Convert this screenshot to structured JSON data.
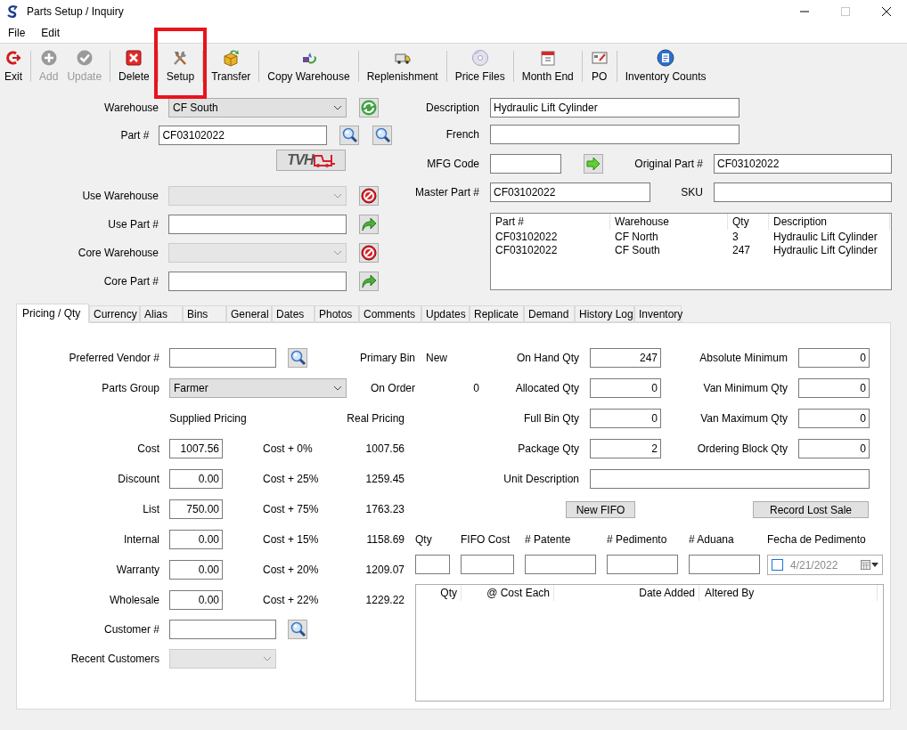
{
  "window": {
    "title": "Parts Setup / Inquiry"
  },
  "menu": [
    "File",
    "Edit"
  ],
  "toolbar": [
    {
      "label": "Exit",
      "disabled": false,
      "highlighted": false
    },
    {
      "label": "Add",
      "disabled": true,
      "highlighted": false
    },
    {
      "label": "Update",
      "disabled": true,
      "highlighted": false
    },
    {
      "label": "Delete",
      "disabled": false,
      "highlighted": false
    },
    {
      "label": "Setup",
      "disabled": false,
      "highlighted": true
    },
    {
      "label": "Transfer",
      "disabled": false,
      "highlighted": false
    },
    {
      "label": "Copy Warehouse",
      "disabled": false,
      "highlighted": false
    },
    {
      "label": "Replenishment",
      "disabled": false,
      "highlighted": false
    },
    {
      "label": "Price Files",
      "disabled": false,
      "highlighted": false
    },
    {
      "label": "Month End",
      "disabled": false,
      "highlighted": false
    },
    {
      "label": "PO",
      "disabled": false,
      "highlighted": false
    },
    {
      "label": "Inventory Counts",
      "disabled": false,
      "highlighted": false
    }
  ],
  "part_lookup": {
    "warehouse": {
      "label": "Warehouse",
      "value": "CF South",
      "disabled": false
    },
    "part": {
      "label": "Part #",
      "value": "CF03102022"
    },
    "logo": {
      "text": "TVH"
    },
    "use_warehouse": {
      "label": "Use Warehouse",
      "disabled": true
    },
    "use_part": {
      "label": "Use Part #"
    },
    "core_warehouse": {
      "label": "Core Warehouse",
      "disabled": true
    },
    "core_part": {
      "label": "Core Part #"
    }
  },
  "details": {
    "description": {
      "label": "Description",
      "value": "Hydraulic Lift Cylinder"
    },
    "french": {
      "label": "French"
    },
    "mfg_code": {
      "label": "MFG Code"
    },
    "original_part": {
      "label": "Original Part #",
      "value": "CF03102022"
    },
    "master_part": {
      "label": "Master Part #",
      "value": "CF03102022"
    },
    "sku": {
      "label": "SKU"
    }
  },
  "warehouse_list": {
    "columns": [
      "Part #",
      "Warehouse",
      "Qty",
      "Description"
    ],
    "rows": [
      [
        "CF03102022",
        "CF North",
        "3",
        "Hydraulic Lift Cylinder"
      ],
      [
        "CF03102022",
        "CF South",
        "247",
        "Hydraulic Lift Cylinder"
      ]
    ]
  },
  "tabs": [
    {
      "label": "Pricing / Qty",
      "selected": true
    },
    {
      "label": "Currency",
      "selected": false
    },
    {
      "label": "Alias",
      "selected": false
    },
    {
      "label": "Bins",
      "selected": false
    },
    {
      "label": "General",
      "selected": false
    },
    {
      "label": "Dates",
      "selected": false
    },
    {
      "label": "Photos",
      "selected": false
    },
    {
      "label": "Comments",
      "selected": false
    },
    {
      "label": "Updates",
      "selected": false
    },
    {
      "label": "Replicate",
      "selected": false
    },
    {
      "label": "Demand",
      "selected": false
    },
    {
      "label": "History Log",
      "selected": false
    },
    {
      "label": "Inventory",
      "selected": false
    }
  ],
  "pricing_tab": {
    "preferred_vendor": {
      "label": "Preferred Vendor #"
    },
    "parts_group": {
      "label": "Parts Group",
      "value": "Farmer"
    },
    "stock_info": [
      {
        "label": "Primary Bin",
        "value": "New"
      },
      {
        "label": "On Order",
        "value": "0"
      }
    ],
    "pricing_headers": [
      "Supplied Pricing",
      "Real Pricing"
    ],
    "pricing": [
      {
        "label": "Cost",
        "value": "1007.56",
        "markup": "Cost + 0%",
        "real": "1007.56"
      },
      {
        "label": "Discount",
        "value": "0.00",
        "markup": "Cost + 25%",
        "real": "1259.45"
      },
      {
        "label": "List",
        "value": "750.00",
        "markup": "Cost + 75%",
        "real": "1763.23"
      },
      {
        "label": "Internal",
        "value": "0.00",
        "markup": "Cost + 15%",
        "real": "1158.69"
      },
      {
        "label": "Warranty",
        "value": "0.00",
        "markup": "Cost + 20%",
        "real": "1209.07"
      },
      {
        "label": "Wholesale",
        "value": "0.00",
        "markup": "Cost + 22%",
        "real": "1229.22"
      }
    ],
    "customer": {
      "label": "Customer #"
    },
    "recent_customers": {
      "label": "Recent Customers",
      "disabled": true
    },
    "quantities": [
      {
        "label": "On Hand Qty",
        "value": "247"
      },
      {
        "label": "Absolute Minimum",
        "value": "0"
      },
      {
        "label": "Allocated Qty",
        "value": "0"
      },
      {
        "label": "Van Minimum Qty",
        "value": "0"
      },
      {
        "label": "Full Bin Qty",
        "value": "0"
      },
      {
        "label": "Van Maximum Qty",
        "value": "0"
      },
      {
        "label": "Package Qty",
        "value": "2"
      },
      {
        "label": "Ordering Block Qty",
        "value": "0"
      }
    ],
    "unit_description": {
      "label": "Unit Description"
    },
    "buttons": [
      "New FIFO",
      "Record Lost Sale"
    ],
    "fifo_fields": [
      "Qty",
      "FIFO Cost",
      "# Patente",
      "# Pedimento",
      "# Aduana"
    ],
    "fifo_date": {
      "label": "Fecha de Pedimento",
      "value": "4/21/2022",
      "checked": false
    },
    "fifo_table": {
      "columns": [
        "Qty",
        "@ Cost Each",
        "Date Added",
        "Altered By"
      ]
    }
  }
}
